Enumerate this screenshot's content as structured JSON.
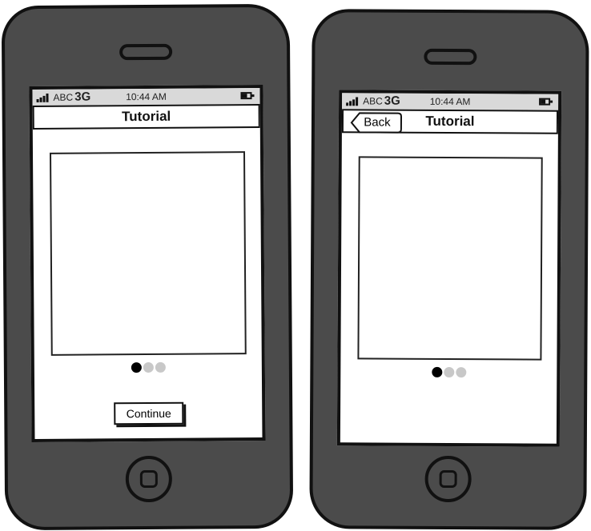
{
  "phones": [
    {
      "status": {
        "carrier": "ABC",
        "network": "3G",
        "time": "10:44 AM"
      },
      "nav": {
        "title": "Tutorial"
      },
      "pager": {
        "pages": 3,
        "current": 1
      },
      "continue_label": "Continue"
    },
    {
      "status": {
        "carrier": "ABC",
        "network": "3G",
        "time": "10:44 AM"
      },
      "nav": {
        "title": "Tutorial",
        "back_label": "Back"
      },
      "pager": {
        "pages": 3,
        "current": 1
      }
    }
  ],
  "icons": [
    "signal-icon",
    "battery-icon",
    "home-button-icon"
  ],
  "colors": {
    "phone_body": "#4b4b4b",
    "outline": "#111111",
    "status_bar": "#d9d9d9",
    "dot_inactive": "#c8c8c8",
    "dot_active": "#000000"
  }
}
